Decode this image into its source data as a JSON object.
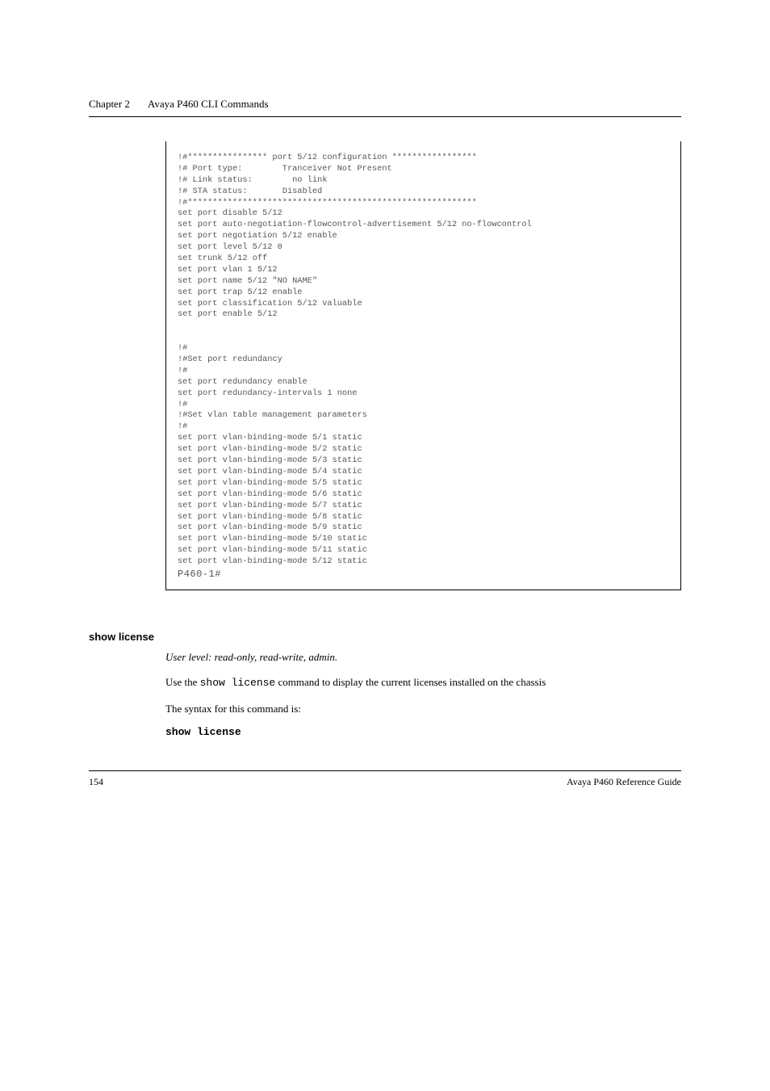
{
  "header": {
    "chapter_label": "Chapter 2",
    "chapter_title": "Avaya P460 CLI Commands"
  },
  "code": {
    "line01": "!#**************** port 5/12 configuration *****************",
    "line02": "!# Port type:        Tranceiver Not Present",
    "line03": "!# Link status:        no link",
    "line04": "!# STA status:       Disabled",
    "line05": "!#**********************************************************",
    "line06": "set port disable 5/12",
    "line07": "set port auto-negotiation-flowcontrol-advertisement 5/12 no-flowcontrol",
    "line08": "set port negotiation 5/12 enable",
    "line09": "set port level 5/12 0",
    "line10": "set trunk 5/12 off",
    "line11": "set port vlan 1 5/12",
    "line12": "set port name 5/12 \"NO NAME\"",
    "line13": "set port trap 5/12 enable",
    "line14": "set port classification 5/12 valuable",
    "line15": "set port enable 5/12",
    "line16": "",
    "line17": "",
    "line18": "!#",
    "line19": "!#Set port redundancy",
    "line20": "!#",
    "line21": "set port redundancy enable",
    "line22": "set port redundancy-intervals 1 none",
    "line23": "!#",
    "line24": "!#Set vlan table management parameters",
    "line25": "!#",
    "line26": "set port vlan-binding-mode 5/1 static",
    "line27": "set port vlan-binding-mode 5/2 static",
    "line28": "set port vlan-binding-mode 5/3 static",
    "line29": "set port vlan-binding-mode 5/4 static",
    "line30": "set port vlan-binding-mode 5/5 static",
    "line31": "set port vlan-binding-mode 5/6 static",
    "line32": "set port vlan-binding-mode 5/7 static",
    "line33": "set port vlan-binding-mode 5/8 static",
    "line34": "set port vlan-binding-mode 5/9 static",
    "line35": "set port vlan-binding-mode 5/10 static",
    "line36": "set port vlan-binding-mode 5/11 static",
    "line37": "set port vlan-binding-mode 5/12 static",
    "prompt": "P460-1#"
  },
  "section": {
    "heading": "show license",
    "user_level": "User level: read-only, read-write, admin.",
    "desc_part1": "Use the ",
    "desc_code": "show license",
    "desc_part2": " command to display the current licenses installed on the chassis",
    "syntax_intro": "The syntax for this command is:",
    "syntax_cmd": "show license"
  },
  "footer": {
    "page": "154",
    "guide": "Avaya P460 Reference Guide"
  }
}
